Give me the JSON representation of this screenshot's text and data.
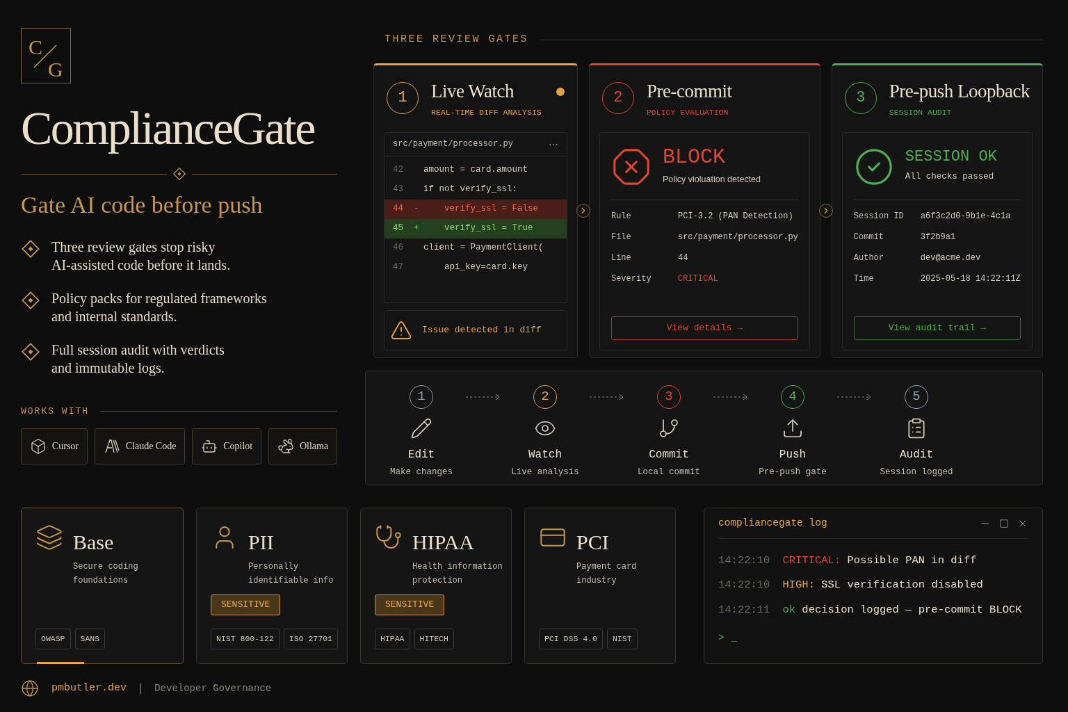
{
  "brand": {
    "logo_top": "C",
    "logo_bottom": "G",
    "title": "ComplianceGate",
    "tagline": "Gate AI code before push"
  },
  "features": [
    "Three review gates stop risky\nAI-assisted code before it lands.",
    "Policy packs for regulated frameworks\nand internal standards.",
    "Full session audit with verdicts\nand immutable logs."
  ],
  "works_with": {
    "heading": "WORKS WITH",
    "tools": [
      "Cursor",
      "Claude Code",
      "Copilot",
      "Ollama"
    ]
  },
  "gates": {
    "heading": "THREE REVIEW GATES",
    "items": [
      {
        "kind": "diff",
        "number": "1",
        "title": "Live Watch",
        "subtitle": "REAL-TIME DIFF ANALYSIS",
        "color": "#e8a23c",
        "live": true,
        "file": "src/payment/processor.py",
        "menu": "···",
        "lines": [
          {
            "number": "42",
            "code": "amount = card.amount",
            "kind": "context"
          },
          {
            "number": "43",
            "code": "if not verify_ssl:",
            "kind": "context"
          },
          {
            "number": "44",
            "marker": "-",
            "code": "    verify_ssl = False",
            "kind": "removed"
          },
          {
            "number": "45",
            "marker": "+",
            "code": "    verify_ssl = True",
            "kind": "added"
          },
          {
            "number": "46",
            "code": "client = PaymentClient(",
            "kind": "context"
          },
          {
            "number": "47",
            "code": "    api_key=card.key",
            "kind": "context"
          }
        ],
        "issue": "Issue detected in diff"
      },
      {
        "kind": "block",
        "number": "2",
        "title": "Pre-commit",
        "subtitle": "POLICY EVALUATION",
        "color": "#e5452f",
        "verdict": "BLOCK",
        "verdict_note": "Policy violuation detected",
        "fields": [
          {
            "label": "Rule",
            "value": "PCI-3.2 (PAN Detection)",
            "kind": "plain"
          },
          {
            "label": "File",
            "value": "src/payment/processor.py",
            "kind": "plain"
          },
          {
            "label": "Line",
            "value": "44",
            "kind": "plain"
          },
          {
            "label": "Severity",
            "value": "CRITICAL",
            "kind": "critical"
          }
        ],
        "button": "View details →"
      },
      {
        "kind": "ok",
        "number": "3",
        "title": "Pre-push Loopback",
        "subtitle": "SESSION AUDIT",
        "color": "#4caf50",
        "verdict": "SESSION OK",
        "verdict_note": "All checks passed",
        "fields": [
          {
            "label": "Session ID",
            "value": "a6f3c2d0-9b1e-4c1a",
            "kind": "plain"
          },
          {
            "label": "Commit",
            "value": "3f2b9a1",
            "kind": "plain"
          },
          {
            "label": "Author",
            "value": "dev@acme.dev",
            "kind": "plain"
          },
          {
            "label": "Time",
            "value": "2025-05-18 14:22:11Z",
            "kind": "plain"
          }
        ],
        "button": "View audit trail →"
      }
    ]
  },
  "pipeline": [
    {
      "number": "1",
      "title": "Edit",
      "subtitle": "Make changes",
      "color": "#8a9aa0"
    },
    {
      "number": "2",
      "title": "Watch",
      "subtitle": "Live analysis",
      "color": "#e8a23c"
    },
    {
      "number": "3",
      "title": "Commit",
      "subtitle": "Local commit",
      "color": "#e5452f"
    },
    {
      "number": "4",
      "title": "Push",
      "subtitle": "Pre-push gate",
      "color": "#4caf50"
    },
    {
      "number": "5",
      "title": "Audit",
      "subtitle": "Session logged",
      "color": "#8fa8c0"
    }
  ],
  "policies": [
    {
      "title": "Base",
      "description": "Secure coding\nfoundations",
      "selected": true,
      "tags": [
        "OWASP",
        "SANS"
      ]
    },
    {
      "title": "PII",
      "description": "Personally\nidentifiable info",
      "selected": false,
      "badge": "SENSITIVE",
      "tags": [
        "NIST 800-122",
        "ISO 27701"
      ]
    },
    {
      "title": "HIPAA",
      "description": "Health information\nprotection",
      "selected": false,
      "badge": "SENSITIVE",
      "tags": [
        "HIPAA",
        "HITECH"
      ]
    },
    {
      "title": "PCI",
      "description": "Payment card\nindustry",
      "selected": false,
      "tags": [
        "PCI DSS 4.0",
        "NIST"
      ]
    }
  ],
  "log": {
    "title": "compliancegate log",
    "lines": [
      {
        "time": "14:22:10",
        "level": "CRITICAL:",
        "kind": "critical",
        "message": "Possible PAN in diff"
      },
      {
        "time": "14:22:10",
        "level": "HIGH:",
        "kind": "high",
        "message": "SSL verification disabled"
      },
      {
        "time": "14:22:11",
        "level": "ok",
        "kind": "ok",
        "message": "decision logged — pre-commit BLOCK"
      }
    ],
    "prompt": ">",
    "cursor": "_"
  },
  "footer": {
    "site": "pmbutler.dev",
    "separator": "|",
    "label": "Developer Governance"
  }
}
